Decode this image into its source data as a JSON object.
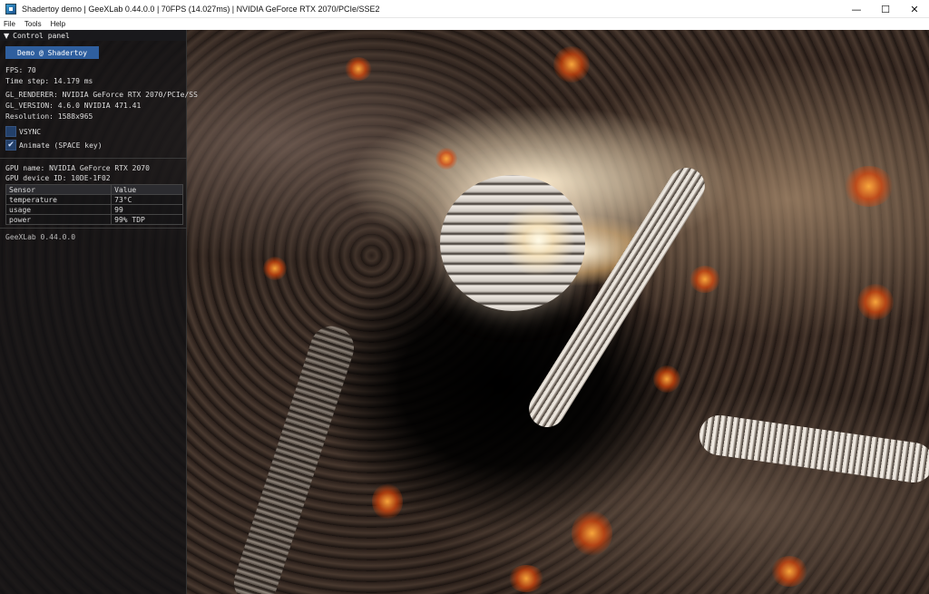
{
  "window": {
    "title": "Shadertoy demo | GeeXLab 0.44.0.0 | 70FPS (14.027ms) | NVIDIA GeForce RTX 2070/PCIe/SSE2",
    "controls": {
      "minimize": "—",
      "maximize": "☐",
      "close": "✕"
    }
  },
  "menu": {
    "items": [
      "File",
      "Tools",
      "Help"
    ]
  },
  "panel": {
    "header": "Control panel",
    "demo_button": "Demo @ Shadertoy",
    "fps": "FPS: 70",
    "time_step": "Time step: 14.179 ms",
    "gl_renderer": "GL_RENDERER: NVIDIA GeForce RTX 2070/PCIe/SS",
    "gl_version": "GL_VERSION: 4.6.0 NVIDIA 471.41",
    "resolution": "Resolution: 1588x965",
    "vsync_label": "VSYNC",
    "vsync_checked": false,
    "animate_label": "Animate (SPACE key)",
    "animate_checked": true,
    "gpu_name": "GPU name: NVIDIA GeForce RTX 2070",
    "gpu_device_id": "GPU device ID: 10DE-1F02",
    "sensor_table": {
      "headers": [
        "Sensor",
        "Value"
      ],
      "rows": [
        [
          "temperature",
          "73°C"
        ],
        [
          "usage",
          "99"
        ],
        [
          "power",
          "99% TDP"
        ]
      ]
    },
    "footer": "GeeXLab 0.44.0.0"
  },
  "colors": {
    "accent_button": "#2f5f9e",
    "panel_bg": "#121214",
    "glow": "#ff8a2a"
  },
  "icons": {
    "app": "geexlab-app-icon",
    "collapse": "triangle-down-icon",
    "check": "checkmark-icon"
  }
}
